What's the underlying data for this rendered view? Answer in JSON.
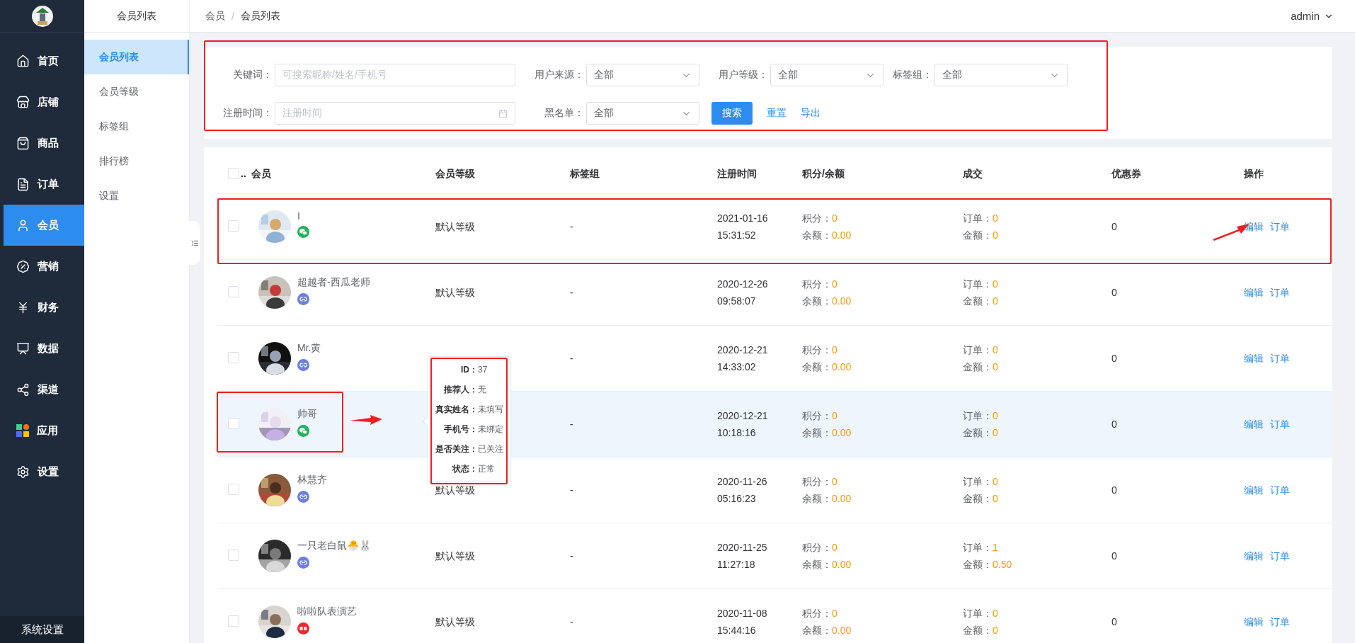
{
  "sidebar": {
    "items": [
      {
        "label": "首页",
        "selected": false
      },
      {
        "label": "店铺",
        "selected": false
      },
      {
        "label": "商品",
        "selected": false
      },
      {
        "label": "订单",
        "selected": false
      },
      {
        "label": "会员",
        "selected": true
      },
      {
        "label": "营销",
        "selected": false
      },
      {
        "label": "财务",
        "selected": false
      },
      {
        "label": "数据",
        "selected": false
      },
      {
        "label": "渠道",
        "selected": false
      },
      {
        "label": "应用",
        "selected": false
      },
      {
        "label": "设置",
        "selected": false
      }
    ],
    "footer": "系统设置"
  },
  "subnav": {
    "title": "会员列表",
    "items": [
      {
        "label": "会员列表",
        "selected": true
      },
      {
        "label": "会员等级",
        "selected": false
      },
      {
        "label": "标签组",
        "selected": false
      },
      {
        "label": "排行榜",
        "selected": false
      },
      {
        "label": "设置",
        "selected": false
      }
    ]
  },
  "breadcrumb": {
    "separator": "/",
    "items": [
      "会员",
      "会员列表"
    ]
  },
  "user": "admin",
  "filters": {
    "fields": [
      {
        "label": "关键词：",
        "kind": "input",
        "placeholder": "可搜索昵称/姓名/手机号"
      },
      {
        "label": "用户来源：",
        "kind": "select",
        "value": "全部"
      },
      {
        "label": "用户等级：",
        "kind": "select",
        "value": "全部"
      },
      {
        "label": "标签组：",
        "kind": "select",
        "value": "全部"
      },
      {
        "label": "注册时间：",
        "kind": "date",
        "placeholder": "注册时间"
      },
      {
        "label": "黑名单：",
        "kind": "select",
        "value": "全部"
      }
    ],
    "buttons": [
      {
        "label": "搜索",
        "kind": "primary"
      },
      {
        "label": "重置",
        "kind": "link"
      },
      {
        "label": "导出",
        "kind": "link"
      }
    ]
  },
  "table": {
    "select_all": {
      "checked": false,
      "label": ".."
    },
    "columns": [
      "会员",
      "会员等级",
      "标签组",
      "注册时间",
      "积分/余额",
      "成交",
      "优惠券",
      "操作"
    ],
    "rows": [
      {
        "checked": false,
        "hovered": false,
        "name": "I",
        "source": {
          "kind": "wechat"
        },
        "level": "默认等级",
        "tags": "-",
        "date": "2021-01-16",
        "time": "15:31:52",
        "points": {
          "label": "积分：",
          "value": "0"
        },
        "balance": {
          "label": "余额：",
          "value": "0.00"
        },
        "orders": {
          "label": "订单：",
          "value": "0"
        },
        "amount": {
          "label": "金额：",
          "value": "0"
        },
        "coupons": "0",
        "actions": [
          "编辑",
          "订单"
        ]
      },
      {
        "checked": false,
        "hovered": false,
        "name": "超越者-西瓜老师",
        "source": {
          "kind": "link"
        },
        "level": "默认等级",
        "tags": "-",
        "date": "2020-12-26",
        "time": "09:58:07",
        "points": {
          "label": "积分：",
          "value": "0"
        },
        "balance": {
          "label": "余额：",
          "value": "0.00"
        },
        "orders": {
          "label": "订单：",
          "value": "0"
        },
        "amount": {
          "label": "金额：",
          "value": "0"
        },
        "coupons": "0",
        "actions": [
          "编辑",
          "订单"
        ]
      },
      {
        "checked": false,
        "hovered": false,
        "name": "Mr.黄",
        "source": {
          "kind": "link"
        },
        "tags": "-",
        "date": "2020-12-21",
        "time": "14:33:02",
        "points": {
          "label": "积分：",
          "value": "0"
        },
        "balance": {
          "label": "余额：",
          "value": "0.00"
        },
        "orders": {
          "label": "订单：",
          "value": "0"
        },
        "amount": {
          "label": "金额：",
          "value": "0"
        },
        "coupons": "0",
        "actions": [
          "编辑",
          "订单"
        ]
      },
      {
        "checked": false,
        "hovered": true,
        "name": "帅哥",
        "source": {
          "kind": "wechat"
        },
        "tags": "-",
        "date": "2020-12-21",
        "time": "10:18:16",
        "points": {
          "label": "积分：",
          "value": "0"
        },
        "balance": {
          "label": "余额：",
          "value": "0.00"
        },
        "orders": {
          "label": "订单：",
          "value": "0"
        },
        "amount": {
          "label": "金额：",
          "value": "0"
        },
        "coupons": "0",
        "actions": [
          "编辑",
          "订单"
        ]
      },
      {
        "checked": false,
        "hovered": false,
        "name": "林慧齐",
        "source": {
          "kind": "link"
        },
        "level": "默认等级",
        "tags": "-",
        "date": "2020-11-26",
        "time": "05:16:23",
        "points": {
          "label": "积分：",
          "value": "0"
        },
        "balance": {
          "label": "余额：",
          "value": "0.00"
        },
        "orders": {
          "label": "订单：",
          "value": "0"
        },
        "amount": {
          "label": "金额：",
          "value": "0"
        },
        "coupons": "0",
        "actions": [
          "编辑",
          "订单"
        ]
      },
      {
        "checked": false,
        "hovered": false,
        "name": "一只老白鼠🐣🐰",
        "source": {
          "kind": "link"
        },
        "level": "默认等级",
        "tags": "-",
        "date": "2020-11-25",
        "time": "11:27:18",
        "points": {
          "label": "积分：",
          "value": "0"
        },
        "balance": {
          "label": "余额：",
          "value": "0.00"
        },
        "orders": {
          "label": "订单：",
          "value": "1"
        },
        "amount": {
          "label": "金额：",
          "value": "0.50"
        },
        "coupons": "0",
        "actions": [
          "编辑",
          "订单"
        ]
      },
      {
        "checked": false,
        "hovered": false,
        "name": "啦啦队表演艺",
        "source": {
          "kind": "app"
        },
        "level": "默认等级",
        "tags": "-",
        "date": "2020-11-08",
        "time": "15:44:16",
        "points": {
          "label": "积分：",
          "value": "0"
        },
        "balance": {
          "label": "余额：",
          "value": "0.00"
        },
        "orders": {
          "label": "订单：",
          "value": "0"
        },
        "amount": {
          "label": "金额：",
          "value": "0"
        },
        "coupons": "0",
        "actions": [
          "编辑",
          "订单"
        ]
      }
    ]
  },
  "tooltip": {
    "rows": [
      {
        "label": "ID：",
        "value": "37"
      },
      {
        "label": "推荐人：",
        "value": "无"
      },
      {
        "label": "真实姓名：",
        "value": "未填写"
      },
      {
        "label": "手机号：",
        "value": "未绑定"
      },
      {
        "label": "是否关注：",
        "value": "已关注"
      },
      {
        "label": "状态：",
        "value": "正常"
      }
    ]
  }
}
